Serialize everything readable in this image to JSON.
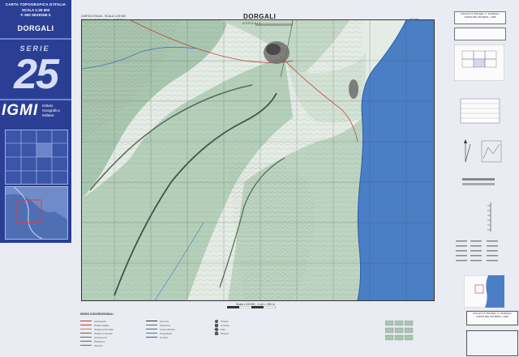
{
  "cover": {
    "line1": "CARTA TOPOGRAFICA D'ITALIA",
    "line2": "SCALA 1:25 000",
    "line3": "F. 500 SEZIONE II",
    "sheet_name": "DORGALI",
    "serie": "SERIE",
    "serie_number": "25",
    "publisher": "IGMI",
    "institute_lines": [
      "Istituto",
      "Geografico",
      "Militare"
    ]
  },
  "sheet": {
    "title": "DORGALI",
    "header_left": [
      "CARTA D'ITALIA - SCALA 1:25 000",
      "FOGLIO N° 500 SEZ. II - DORGALI"
    ],
    "header_right": "N Cala",
    "top_label": "DORGALI",
    "scale_caption": "Scala 1:25 000 - 1 cm = 250 m"
  },
  "legend": {
    "title": "SEGNI CONVENZIONALI",
    "column_a": [
      "Autostrada",
      "Strada statale",
      "Strada provinciale",
      "Strada comunale",
      "Carrareccia",
      "Mulattiera",
      "Sentiero"
    ],
    "column_b": [
      "Ferrovia",
      "Teleferica",
      "Linea elettrica",
      "Acquedotto",
      "Confine"
    ],
    "column_c": [
      "Chiesa",
      "Cimitero",
      "Faro",
      "Miniera"
    ]
  },
  "right_panel": {
    "box1": [
      "FOGLIO N° 500 SEZ. II - DORGALI",
      "CARTA DEL SISTEMA - 1999"
    ],
    "footer_box": [
      "FOGLIO N° 500 SEZ. II - DORGALI",
      "CARTA DEL SISTEMA - 1999"
    ]
  },
  "colors": {
    "cover_blue": "#2a3f93",
    "terrain_green": "#a8c7b0",
    "terrain_light": "#e4ece6",
    "sea_blue": "#4a7fc6",
    "contour": "#8a7a6a"
  }
}
